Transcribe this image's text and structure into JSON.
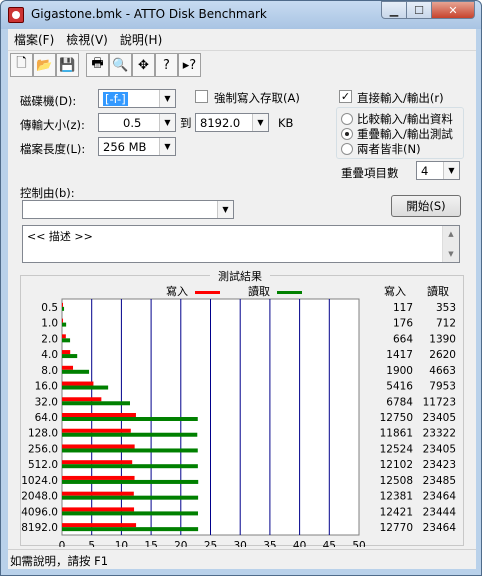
{
  "window": {
    "title": "Gigastone.bmk - ATTO Disk Benchmark"
  },
  "menu": [
    "檔案(F)",
    "檢視(V)",
    "說明(H)"
  ],
  "toolbar": [
    "new-icon",
    "open-icon",
    "save-icon",
    "print-icon",
    "print-preview-icon",
    "move-icon",
    "help-icon",
    "context-help-icon"
  ],
  "settings": {
    "drive_label": "磁碟機(D):",
    "drive_value": "[-f-]",
    "force_write_label": "強制寫入存取(A)",
    "force_write_checked": false,
    "direct_io_label": "直接輸入/輸出(r)",
    "direct_io_checked": true,
    "transfer_label": "傳輸大小(z):",
    "transfer_from": "0.5",
    "to_label": "到",
    "transfer_to": "8192.0",
    "kb_label": "KB",
    "file_len_label": "檔案長度(L):",
    "file_len_value": "256 MB",
    "radio_compare": "比較輸入/輸出資料",
    "radio_overlap": "重疊輸入/輸出測試",
    "radio_neither": "兩者皆非(N)",
    "radio_selected": 1,
    "queue_label": "重疊項目數",
    "queue_value": "4",
    "controlled_label": "控制由(b):",
    "controlled_value": "",
    "start_button": "開始(S)",
    "desc_text": "<<    描述    >>"
  },
  "results": {
    "title": "測試結果",
    "write_legend": "寫入",
    "read_legend": "讀取",
    "col_write": "寫入",
    "col_read": "讀取",
    "xlabel": "傳輸速率 - MB / 秒"
  },
  "colors": {
    "write": "#ff0000",
    "read": "#008000",
    "grid": "#00008b"
  },
  "status": "如需說明，請按 F1",
  "chart_data": {
    "type": "bar",
    "categories": [
      "0.5",
      "1.0",
      "2.0",
      "4.0",
      "8.0",
      "16.0",
      "32.0",
      "64.0",
      "128.0",
      "256.0",
      "512.0",
      "1024.0",
      "2048.0",
      "4096.0",
      "8192.0"
    ],
    "series": [
      {
        "name": "寫入",
        "values": [
          117,
          176,
          664,
          1417,
          1900,
          5416,
          6784,
          12750,
          11861,
          12524,
          12102,
          12508,
          12381,
          12421,
          12770
        ]
      },
      {
        "name": "讀取",
        "values": [
          353,
          712,
          1390,
          2620,
          4663,
          7953,
          11723,
          23405,
          23322,
          23405,
          23423,
          23485,
          23464,
          23444,
          23464
        ]
      }
    ],
    "xlim": [
      0,
      50
    ],
    "xticks": [
      0,
      5,
      10,
      15,
      20,
      25,
      30,
      35,
      40,
      45,
      50
    ],
    "xlabel": "傳輸速率 - MB / 秒",
    "grid": true,
    "legend": "top"
  }
}
